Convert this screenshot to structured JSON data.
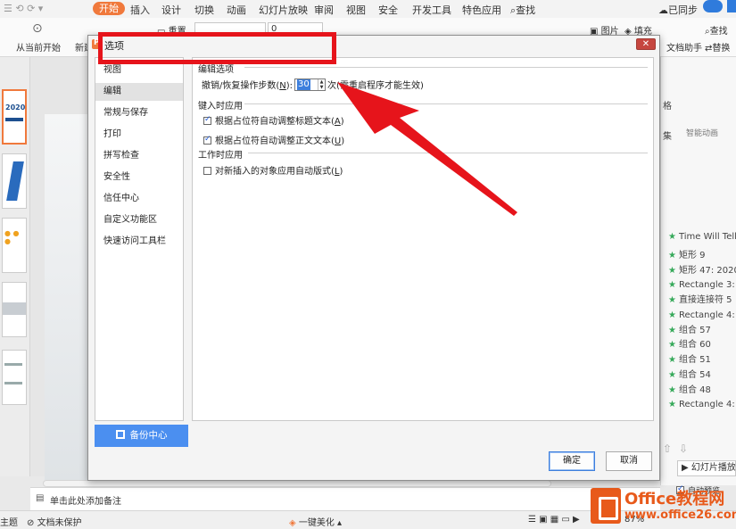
{
  "ribbon": {
    "tabs": [
      "开始",
      "插入",
      "设计",
      "切换",
      "动画",
      "幻灯片放映",
      "审阅",
      "视图",
      "安全",
      "开发工具",
      "特色应用",
      "查找"
    ],
    "sync": "已同步",
    "play_from_current": "从当前开始",
    "new_label": "新建",
    "reset": "重置",
    "font_size_value": "0",
    "picture": "图片",
    "fill": "填充",
    "find": "查找",
    "replace": "替换",
    "doc_assistant": "文档助手",
    "smart_animation": "智能动画",
    "format_label": "格",
    "set_label": "集"
  },
  "selection_pane": {
    "items": [
      "Time Will Tell.mp3",
      "矩形 9",
      "矩形 47: 2020",
      "Rectangle 3: 述职",
      "直接连接符 5",
      "Rectangle 4: 框架",
      "组合 57",
      "组合 60",
      "组合 51",
      "组合 54",
      "组合 48",
      "Rectangle 4: 理想"
    ],
    "slideshow_button": "幻灯片播放",
    "auto_preview": "自动预览"
  },
  "notes_placeholder": "单击此处添加备注",
  "statusbar": {
    "theme": "主题",
    "doc_protect": "文档未保护",
    "beautify": "一键美化",
    "zoom": "87%"
  },
  "watermark": {
    "brand": "Office教程网",
    "url": "www.office26.com"
  },
  "dialog": {
    "title": "选项",
    "nav": [
      "视图",
      "编辑",
      "常规与保存",
      "打印",
      "拼写检查",
      "安全性",
      "信任中心",
      "自定义功能区",
      "快速访问工具栏"
    ],
    "selected_nav": "编辑",
    "backup_center": "备份中心",
    "sections": {
      "edit_options": "编辑选项",
      "type_apply": "键入时应用",
      "work_apply": "工作时应用"
    },
    "undo": {
      "label_prefix": "撤销/恢复操作步数(",
      "accel": "N",
      "label_suffix": "):",
      "value": "30",
      "note": "次(需重启程序才能生效)"
    },
    "options": [
      {
        "text": "根据占位符自动调整标题文本(",
        "accel": "A",
        "end": ")",
        "checked": true
      },
      {
        "text": "根据占位符自动调整正文文本(",
        "accel": "U",
        "end": ")",
        "checked": true
      },
      {
        "text": "对新插入的对象应用自动版式(",
        "accel": "L",
        "end": ")",
        "checked": false
      }
    ],
    "ok": "确定",
    "cancel": "取消"
  },
  "colors": {
    "accent_orange": "#f0793c",
    "highlight_red": "#e6141b",
    "primary_blue": "#4b8ff0"
  }
}
